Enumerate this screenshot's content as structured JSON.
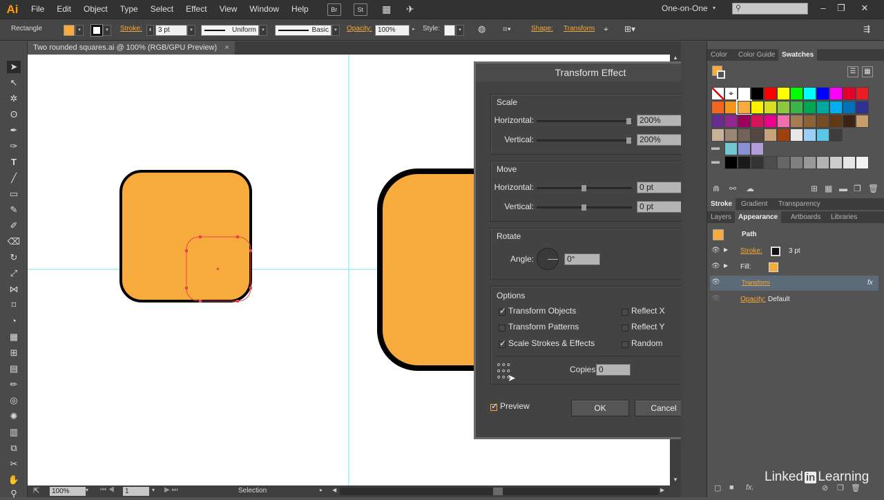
{
  "app": {
    "logo": "Ai"
  },
  "menu": [
    "File",
    "Edit",
    "Object",
    "Type",
    "Select",
    "Effect",
    "View",
    "Window",
    "Help"
  ],
  "menubar_buttons": {
    "br": "Br",
    "st": "St"
  },
  "workspace": "One-on-One",
  "window_controls": {
    "minimize": "–",
    "restore": "❐",
    "close": "✕"
  },
  "control_bar": {
    "object_type": "Rectangle",
    "stroke_label": "Stroke:",
    "stroke_weight": "3 pt",
    "profile": "Uniform",
    "brush": "Basic",
    "opacity_label": "Opacity:",
    "opacity": "100%",
    "style_label": "Style:",
    "shape_label": "Shape:",
    "transform_label": "Transform"
  },
  "document_tab": {
    "title": "Two rounded squares.ai @ 100% (RGB/GPU Preview)",
    "close": "×"
  },
  "status_bar": {
    "zoom": "100%",
    "artboard": "1",
    "tool": "Selection"
  },
  "dialog": {
    "title": "Transform Effect",
    "scale": {
      "title": "Scale",
      "horizontal_label": "Horizontal:",
      "horizontal": "200%",
      "vertical_label": "Vertical:",
      "vertical": "200%"
    },
    "move": {
      "title": "Move",
      "horizontal_label": "Horizontal:",
      "horizontal": "0 pt",
      "vertical_label": "Vertical:",
      "vertical": "0 pt"
    },
    "rotate": {
      "title": "Rotate",
      "angle_label": "Angle:",
      "angle": "0°"
    },
    "options": {
      "title": "Options",
      "transform_objects": "Transform Objects",
      "transform_patterns": "Transform Patterns",
      "scale_strokes": "Scale Strokes & Effects",
      "reflect_x": "Reflect X",
      "reflect_y": "Reflect Y",
      "random": "Random",
      "copies_label": "Copies",
      "copies": "0"
    },
    "preview": "Preview",
    "ok": "OK",
    "cancel": "Cancel"
  },
  "panels": {
    "swatch_tabs": [
      "Color",
      "Color Guide",
      "Swatches"
    ],
    "stroke_tabs": [
      "Stroke",
      "Gradient",
      "Transparency"
    ],
    "appearance_tabs": [
      "Layers",
      "Appearance",
      "Artboards",
      "Libraries"
    ],
    "appearance": {
      "object": "Path",
      "stroke_label": "Stroke:",
      "stroke_value": "3 pt",
      "fill_label": "Fill:",
      "effect": "Transform",
      "fx": "fx",
      "opacity_label": "Opacity:",
      "opacity_value": "Default"
    }
  },
  "colors": {
    "fill_orange": "#f7ab3c",
    "stroke_black": "#000000",
    "guide_cyan": "#6ee6ee",
    "selection_red": "#e8434a",
    "accent_orange": "#f7a93b"
  },
  "watermark": {
    "text_before": "Linked",
    "text_box": "in",
    "text_after": "Learning"
  }
}
